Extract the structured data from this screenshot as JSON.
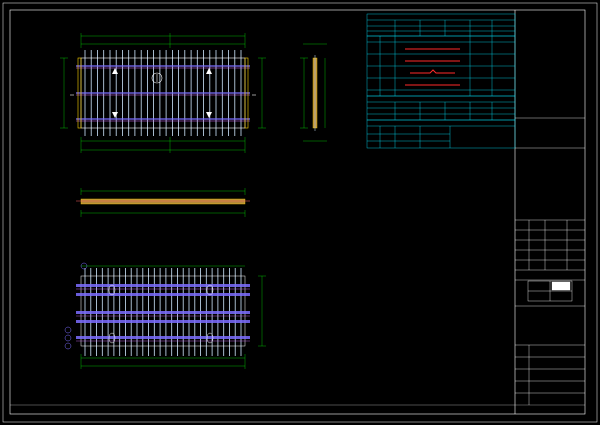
{
  "colors": {
    "background": "#000000",
    "frame": "#ffffff",
    "dimension": "#00e000",
    "rebar_vertical": "#cfe8ff",
    "rebar_main": "#7b6cff",
    "rebar_cross": "#d86cff",
    "table": "#00e5ff",
    "concrete": "#b58a3a",
    "highlight": "#ff2a2a",
    "titleblock": "#ffffff"
  },
  "title_block": {
    "drawing_title": "",
    "note_text": "",
    "sheet_number": ""
  },
  "views": {
    "plan_label": "",
    "section_label": "",
    "bottom_label": "",
    "side_label": ""
  },
  "tables": {
    "rebar_table_title": "",
    "material_table_title": "",
    "summary_table_title": ""
  }
}
